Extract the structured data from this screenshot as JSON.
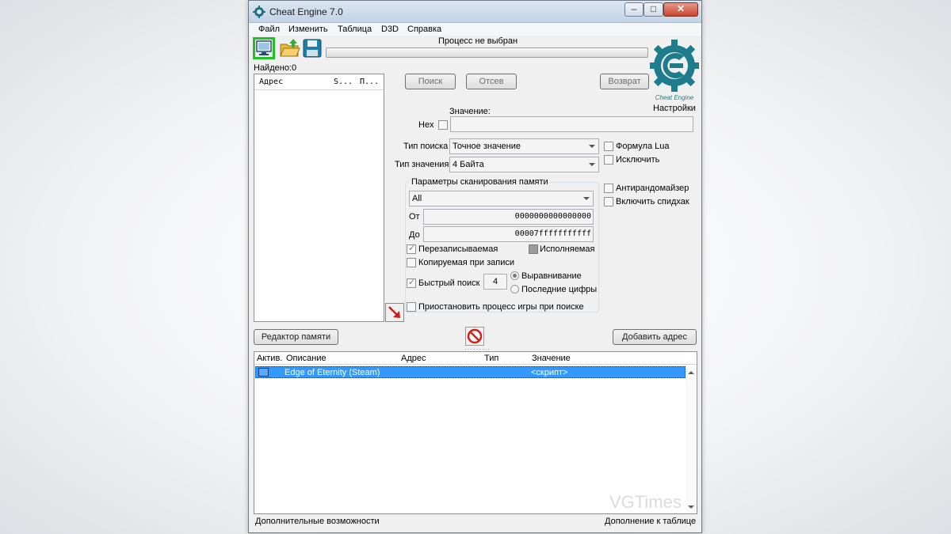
{
  "window": {
    "title": "Cheat Engine 7.0"
  },
  "menu": [
    "Файл",
    "Изменить",
    "Таблица",
    "D3D",
    "Справка"
  ],
  "toolbar": {
    "process_label": "Процесс не выбран",
    "progress": 0
  },
  "found": "Найдено:0",
  "settings_link": "Настройки",
  "logo_text": "Cheat Engine",
  "address_list": {
    "columns": [
      "Адрес",
      "S...",
      "П..."
    ]
  },
  "scan": {
    "first_scan": "Поиск",
    "next_scan": "Отсев",
    "undo_scan": "Возврат",
    "value_label": "Значение:",
    "hex_label": "Hex",
    "scan_type_label": "Тип поиска",
    "scan_type_value": "Точное значение",
    "value_type_label": "Тип значения",
    "value_type_value": "4 Байта",
    "lua_formula": "Формула Lua",
    "not_label": "Исключить",
    "unrandomizer": "Антирандомайзер",
    "speedhack": "Включить спидхак"
  },
  "mem_options": {
    "title": "Параметры сканирования памяти",
    "region": "All",
    "from_label": "От",
    "from_value": "0000000000000000",
    "to_label": "До",
    "to_value": "00007fffffffffff",
    "writable": "Перезаписываемая",
    "executable": "Исполняемая",
    "copy_on_write": "Копируемая при записи",
    "fast_scan": "Быстрый поиск",
    "fast_scan_value": "4",
    "alignment": "Выравнивание",
    "last_digits": "Последние цифры",
    "pause_game": "Приостановить процесс игры при поиске"
  },
  "buttons": {
    "memory_view": "Редактор памяти",
    "add_address": "Добавить адрес"
  },
  "cheat_table": {
    "columns": [
      "Актив.",
      "Описание",
      "Адрес",
      "Тип",
      "Значение"
    ],
    "rows": [
      {
        "description": "Edge of Eternity (Steam)",
        "address": "",
        "type": "",
        "value": "<скрипт>"
      }
    ]
  },
  "status": {
    "left": "Дополнительные возможности",
    "right": "Дополнение к таблице"
  },
  "watermark": "VGTimes",
  "colors": {
    "selection": "#3399ff",
    "logo": "#1e7d8c",
    "highlight": "#22c022"
  }
}
